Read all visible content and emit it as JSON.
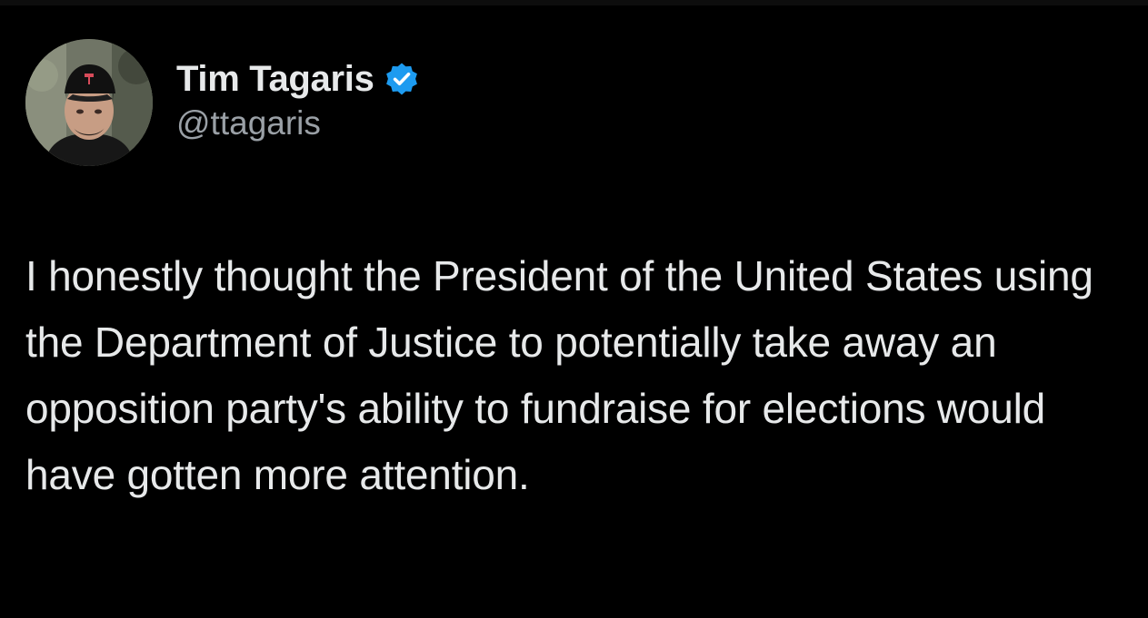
{
  "colors": {
    "background": "#000000",
    "text_primary": "#e7e9ea",
    "text_secondary": "#9aa0a6",
    "verified_badge": "#1d9bf0"
  },
  "author": {
    "avatar_icon": "profile-photo",
    "display_name": "Tim Tagaris",
    "verified_icon": "verified-badge-icon",
    "handle": "@ttagaris"
  },
  "tweet": {
    "text": "I honestly thought the President of the United States using the Department of Justice to potentially take away an opposition party's ability to fundraise for elections would have gotten more attention."
  }
}
